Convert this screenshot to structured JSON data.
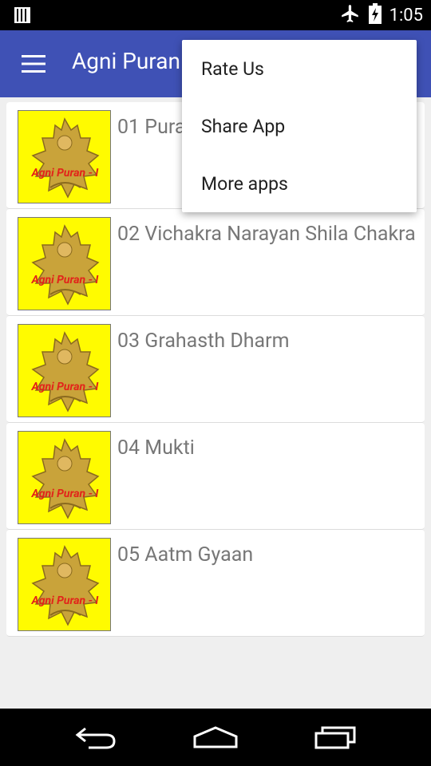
{
  "status_bar": {
    "time": "1:05",
    "icons": [
      "notification-bars-icon",
      "airplane-mode-icon",
      "battery-charging-icon"
    ]
  },
  "app_bar": {
    "title": "Agni Puran",
    "menu_icon": "hamburger-menu-icon",
    "color": "#3f51b5"
  },
  "list": {
    "items": [
      {
        "label": "01 Puran",
        "thumb_caption": "Agni Puran - I"
      },
      {
        "label": "02 Vichakra Narayan Shila Chakra",
        "thumb_caption": "Agni Puran - I"
      },
      {
        "label": "03 Grahasth Dharm",
        "thumb_caption": "Agni Puran - I"
      },
      {
        "label": "04 Mukti",
        "thumb_caption": "Agni Puran - I"
      },
      {
        "label": "05 Aatm Gyaan",
        "thumb_caption": "Agni Puran - I"
      }
    ]
  },
  "overflow_menu": {
    "items": [
      "Rate Us",
      "Share App",
      "More apps"
    ]
  },
  "nav_bar": {
    "icons": [
      "back-icon",
      "home-icon",
      "recent-apps-icon"
    ]
  }
}
